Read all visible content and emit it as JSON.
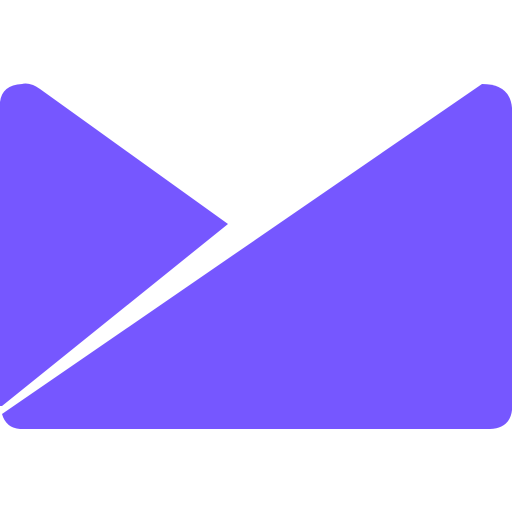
{
  "icon": {
    "name": "envelope-mail-icon",
    "color": "#7657FF",
    "background": "#FFFFFF"
  }
}
